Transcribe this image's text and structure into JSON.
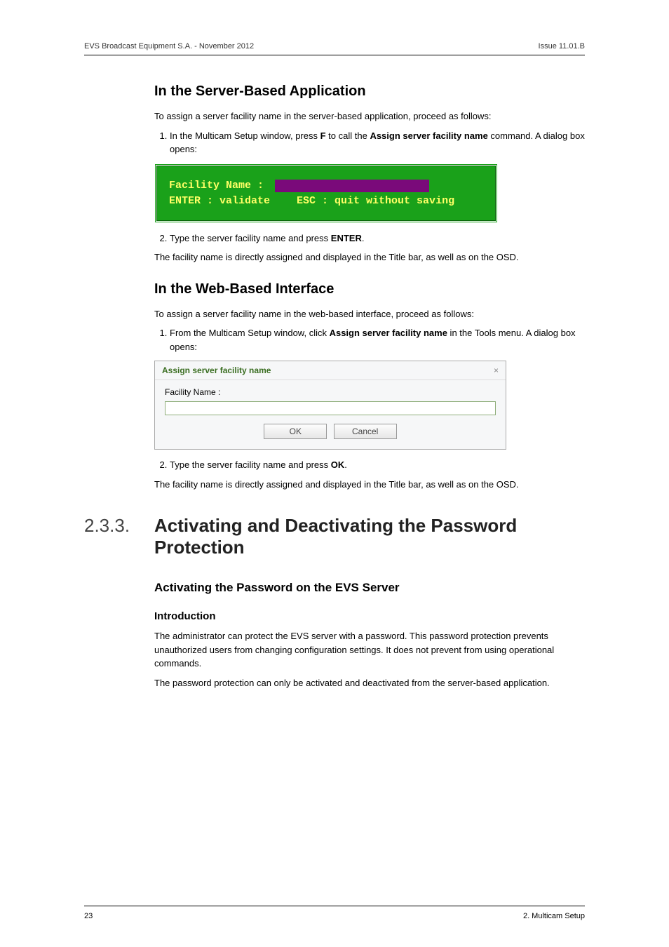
{
  "header": {
    "left": "EVS Broadcast Equipment S.A.  - November 2012",
    "right": "Issue 11.01.B"
  },
  "section1": {
    "title": "In the Server-Based Application",
    "intro": "To assign a server facility name in the server-based application, proceed as follows:",
    "step1_a": "In the Multicam Setup window, press ",
    "step1_key": "F",
    "step1_b": " to call the ",
    "step1_c": "Assign server facility name",
    "step1_d": " command. A dialog box opens:",
    "term": {
      "label": "Facility Name :",
      "enter": "ENTER : validate",
      "esc": "ESC : quit without saving"
    },
    "step2_a": "Type the server facility name and press ",
    "step2_key": "ENTER",
    "step2_b": ".",
    "outro": "The facility name is directly assigned and displayed in the Title bar, as well as on the OSD."
  },
  "section2": {
    "title": "In the Web-Based Interface",
    "intro": "To assign a server facility name in the web-based interface, proceed as follows:",
    "step1_a": "From the Multicam Setup window, click ",
    "step1_b": "Assign server facility name",
    "step1_c": " in the Tools menu. A dialog box opens:",
    "dlg": {
      "title": "Assign server facility name",
      "close": "×",
      "label": "Facility Name :",
      "ok": "OK",
      "cancel": "Cancel"
    },
    "step2_a": "Type the server facility name and press ",
    "step2_key": "OK",
    "step2_b": ".",
    "outro": "The facility name is directly assigned and displayed in the Title bar, as well as on the OSD."
  },
  "section3": {
    "num": "2.3.3.",
    "title": "Activating and Deactivating the Password Protection",
    "sub": "Activating the Password on the EVS Server",
    "subsub": "Introduction",
    "p1": "The administrator can protect the EVS server with a password. This password protection prevents unauthorized users from changing configuration settings. It does not prevent from using operational commands.",
    "p2": "The password protection can only be activated and deactivated from the server-based application."
  },
  "footer": {
    "left": "23",
    "right": "2. Multicam Setup"
  }
}
